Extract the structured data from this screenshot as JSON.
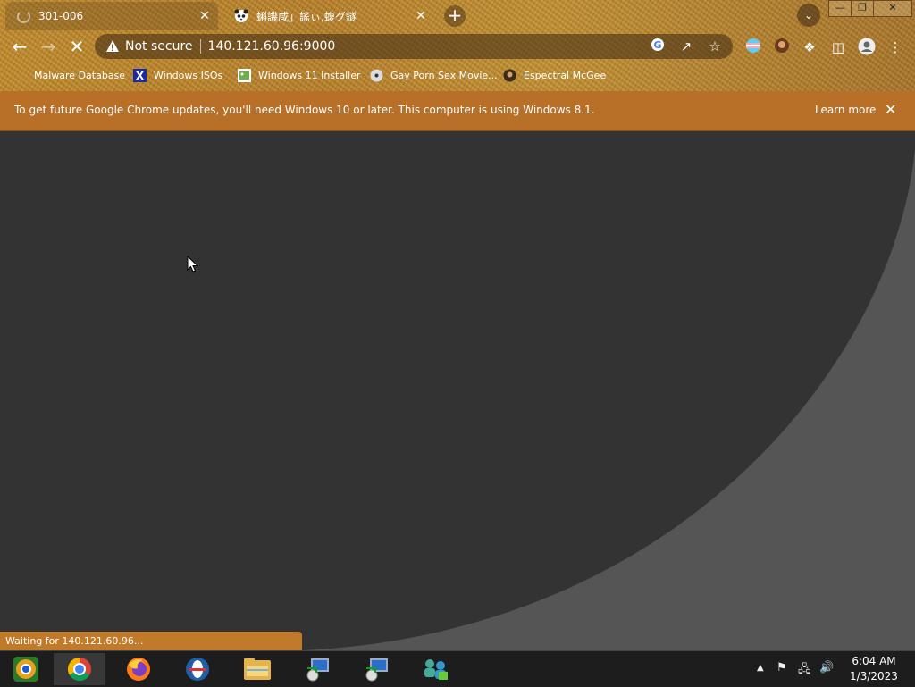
{
  "browser": {
    "tabs": [
      {
        "title": "301-006",
        "close": "✕",
        "loading": true
      },
      {
        "title": "蝌譏咸」謠ぃ,蝮グ鐩",
        "close": "✕"
      }
    ],
    "new_tab": "+",
    "address": {
      "security_label": "Not secure",
      "url": "140.121.60.96:9000"
    },
    "bookmarks": [
      {
        "label": "Malware Database",
        "icon": "none"
      },
      {
        "label": "Windows ISOs",
        "icon": "x-logo"
      },
      {
        "label": "Windows 11 Installer",
        "icon": "image-icon"
      },
      {
        "label": "Gay Porn Sex Movie...",
        "icon": "disc-icon"
      },
      {
        "label": "Espectral McGee",
        "icon": "avatar-icon"
      }
    ]
  },
  "infobar": {
    "message": "To get future Google Chrome updates, you'll need Windows 10 or later. This computer is using Windows 8.1.",
    "learn_more": "Learn more",
    "close": "✕"
  },
  "status_bar": "Waiting for 140.121.60.96...",
  "taskbar": {
    "apps": [
      "chrome-canary",
      "google-chrome",
      "firefox",
      "opera",
      "file-explorer",
      "remote-desktop",
      "remote-desktop-2",
      "network-app"
    ],
    "clock": {
      "time": "6:04 AM",
      "date": "1/3/2023"
    }
  },
  "colors": {
    "infobar": "#b86f28",
    "content_bg": "#3c3c3c",
    "taskbar": "#1d1d1d"
  }
}
